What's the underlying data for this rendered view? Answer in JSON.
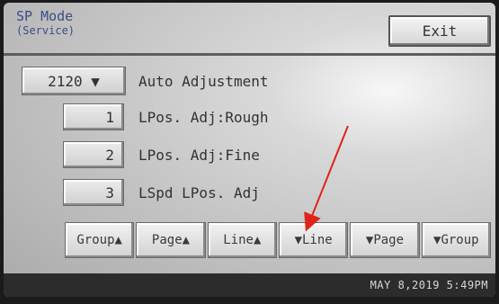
{
  "header": {
    "title": "SP Mode",
    "subtitle": "(Service)",
    "exit_label": "Exit"
  },
  "code_selector": {
    "value": "2120 ▼",
    "label": "Auto Adjustment"
  },
  "items": [
    {
      "number": "1",
      "label": "LPos. Adj:Rough"
    },
    {
      "number": "2",
      "label": "LPos. Adj:Fine"
    },
    {
      "number": "3",
      "label": "LSpd LPos. Adj"
    }
  ],
  "nav": [
    {
      "label": "Group▲"
    },
    {
      "label": "Page▲"
    },
    {
      "label": "Line▲"
    },
    {
      "label": "▼Line"
    },
    {
      "label": "▼Page"
    },
    {
      "label": "▼Group"
    }
  ],
  "status": {
    "datetime": "MAY   8,2019  5:49PM"
  },
  "annotation": {
    "color": "#e0241b"
  }
}
